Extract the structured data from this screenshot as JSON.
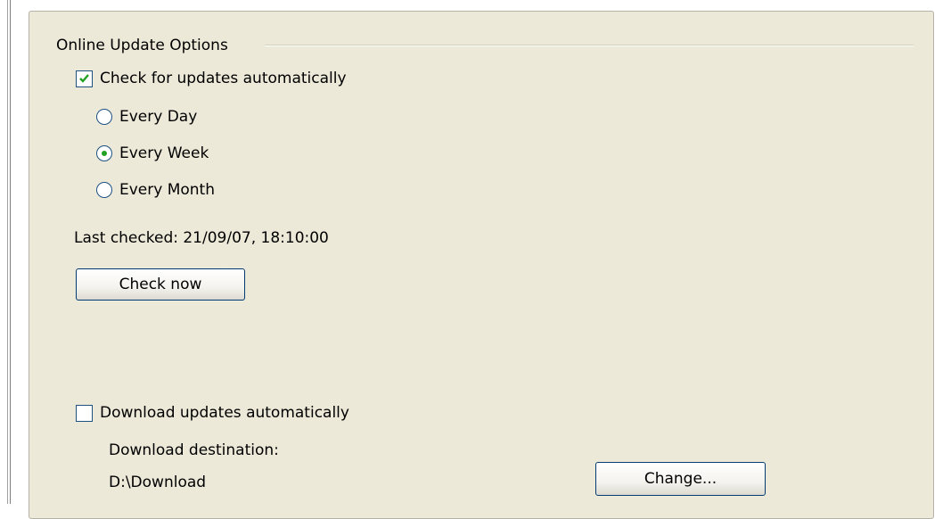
{
  "group": {
    "title": "Online Update Options"
  },
  "check_updates": {
    "label": "Check for updates automatically",
    "checked": true
  },
  "frequency": {
    "options": [
      {
        "label": "Every Day",
        "selected": false
      },
      {
        "label": "Every Week",
        "selected": true
      },
      {
        "label": "Every Month",
        "selected": false
      }
    ]
  },
  "last_checked": {
    "text": "Last checked: 21/09/07, 18:10:00"
  },
  "check_now": {
    "label": "Check now"
  },
  "download_auto": {
    "label": "Download updates automatically",
    "checked": false
  },
  "download_destination": {
    "label": "Download destination:",
    "path": "D:\\Download"
  },
  "change_button": {
    "label": "Change..."
  },
  "colors": {
    "panel_background": "#ece9d8",
    "checkmark_green": "#21a121",
    "control_border": "#1c5180",
    "button_border": "#003c74"
  }
}
